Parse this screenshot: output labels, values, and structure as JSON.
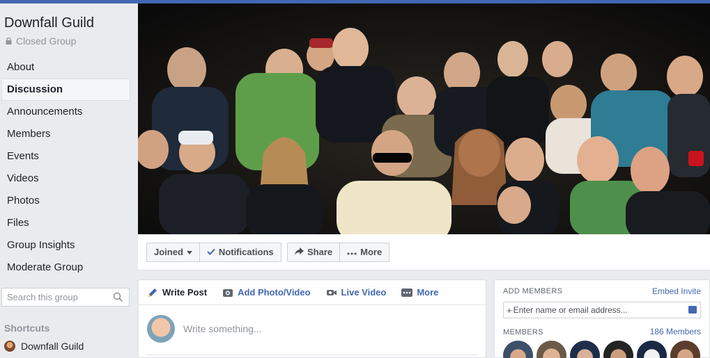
{
  "group": {
    "name": "Downfall Guild",
    "privacy": "Closed Group"
  },
  "sidebar": {
    "items": [
      {
        "label": "About"
      },
      {
        "label": "Discussion",
        "active": true
      },
      {
        "label": "Announcements"
      },
      {
        "label": "Members"
      },
      {
        "label": "Events"
      },
      {
        "label": "Videos"
      },
      {
        "label": "Photos"
      },
      {
        "label": "Files"
      },
      {
        "label": "Group Insights"
      },
      {
        "label": "Moderate Group"
      }
    ],
    "search_placeholder": "Search this group",
    "shortcuts_title": "Shortcuts",
    "shortcut_item": "Downfall Guild"
  },
  "actions": {
    "joined": "Joined",
    "notifications": "Notifications",
    "share": "Share",
    "more": "More"
  },
  "composer": {
    "tabs": [
      "Write Post",
      "Add Photo/Video",
      "Live Video",
      "More"
    ],
    "placeholder": "Write something..."
  },
  "members_panel": {
    "add_title": "ADD MEMBERS",
    "embed_link": "Embed Invite",
    "input_placeholder": "Enter name or email address...",
    "members_title": "MEMBERS",
    "members_count": "186 Members"
  },
  "colors": {
    "brand": "#4267b2",
    "page_bg": "#e9ebee"
  }
}
